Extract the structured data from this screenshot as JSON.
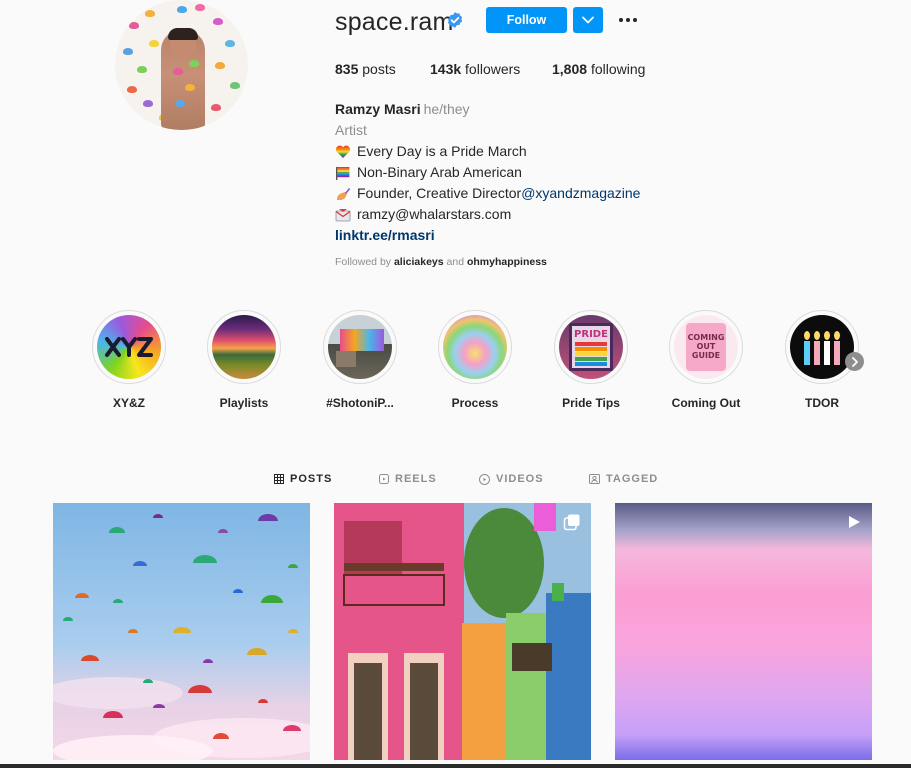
{
  "profile": {
    "username": "space.ram",
    "follow_label": "Follow",
    "stats": {
      "posts": "835",
      "posts_label": "posts",
      "followers": "143k",
      "followers_label": "followers",
      "following": "1,808",
      "following_label": "following"
    },
    "name": "Ramzy Masri",
    "pronouns": "he/they",
    "category": "Artist",
    "bio_lines": [
      "Every Day is a Pride March",
      "Non-Binary Arab American",
      "Founder, Creative Director ",
      "ramzy@whalarstars.com"
    ],
    "bio_mention": "@xyandzmagazine",
    "link": "linktr.ee/rmasri",
    "followed_by_prefix": "Followed by ",
    "followed_by_users": [
      "aliciakeys",
      "ohmyhappiness"
    ],
    "followed_by_joiner": " and "
  },
  "highlights": [
    {
      "label": "XY&Z",
      "icon": "xyz-highlight"
    },
    {
      "label": "Playlists",
      "icon": "sunset-highlight"
    },
    {
      "label": "#ShotoniP...",
      "icon": "billboard-highlight"
    },
    {
      "label": "Process",
      "icon": "rainbow-highlight"
    },
    {
      "label": "Pride Tips",
      "icon": "pride-sign-highlight"
    },
    {
      "label": "Coming Out",
      "icon": "coming-out-guide-highlight"
    },
    {
      "label": "TDOR",
      "icon": "candles-highlight"
    }
  ],
  "highlight_art": {
    "pride_sign": "PRIDE",
    "coming_out": [
      "COMING",
      "OUT",
      "GUIDE"
    ]
  },
  "tabs": [
    {
      "label": "POSTS",
      "icon": "grid-icon",
      "active": true
    },
    {
      "label": "REELS",
      "icon": "reels-icon",
      "active": false
    },
    {
      "label": "VIDEOS",
      "icon": "igtv-icon",
      "active": false
    },
    {
      "label": "TAGGED",
      "icon": "tagged-icon",
      "active": false
    }
  ],
  "colors": {
    "accent": "#0095f6",
    "text": "#262626",
    "muted": "#8e8e8e",
    "link": "#00376b",
    "background": "#fafafa"
  }
}
